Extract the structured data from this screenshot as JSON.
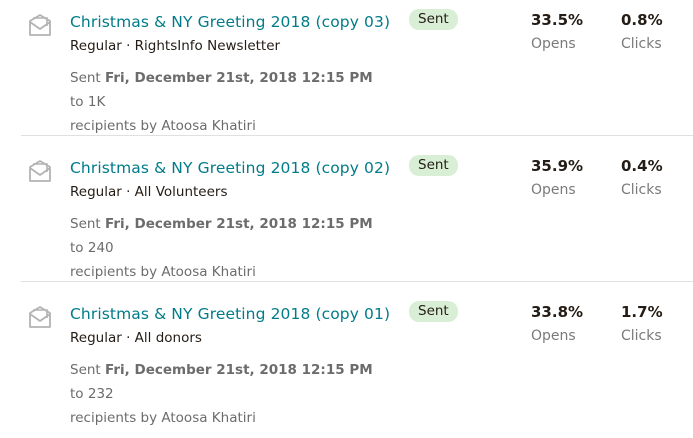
{
  "campaigns": [
    {
      "title": "Christmas & NY Greeting 2018 (copy 03)",
      "type": "Regular",
      "separator": "·",
      "audience": "RightsInfo Newsletter",
      "sent_prefix": "Sent",
      "sent_date": "Fri, December 21st, 2018 12:15 PM",
      "to_word": "to",
      "recipient_count": "1K",
      "recipients_by": "recipients by Atoosa Khatiri",
      "status": "Sent",
      "opens_value": "33.5%",
      "opens_label": "Opens",
      "clicks_value": "0.8%",
      "clicks_label": "Clicks",
      "icon": "email-envelope-icon"
    },
    {
      "title": "Christmas & NY Greeting 2018 (copy 02)",
      "type": "Regular",
      "separator": "·",
      "audience": "All Volunteers",
      "sent_prefix": "Sent",
      "sent_date": "Fri, December 21st, 2018 12:15 PM",
      "to_word": "to",
      "recipient_count": "240",
      "recipients_by": "recipients by Atoosa Khatiri",
      "status": "Sent",
      "opens_value": "35.9%",
      "opens_label": "Opens",
      "clicks_value": "0.4%",
      "clicks_label": "Clicks",
      "icon": "email-envelope-icon"
    },
    {
      "title": "Christmas & NY Greeting 2018 (copy 01)",
      "type": "Regular",
      "separator": "·",
      "audience": "All donors",
      "sent_prefix": "Sent",
      "sent_date": "Fri, December 21st, 2018 12:15 PM",
      "to_word": "to",
      "recipient_count": "232",
      "recipients_by": "recipients by Atoosa Khatiri",
      "status": "Sent",
      "opens_value": "33.8%",
      "opens_label": "Opens",
      "clicks_value": "1.7%",
      "clicks_label": "Clicks",
      "icon": "email-envelope-icon"
    }
  ],
  "colors": {
    "link": "#007c89",
    "badge_bg": "#d8efd6",
    "text": "#241c15",
    "muted": "#6c6c6c",
    "icon_stroke": "#b3b3b3"
  }
}
